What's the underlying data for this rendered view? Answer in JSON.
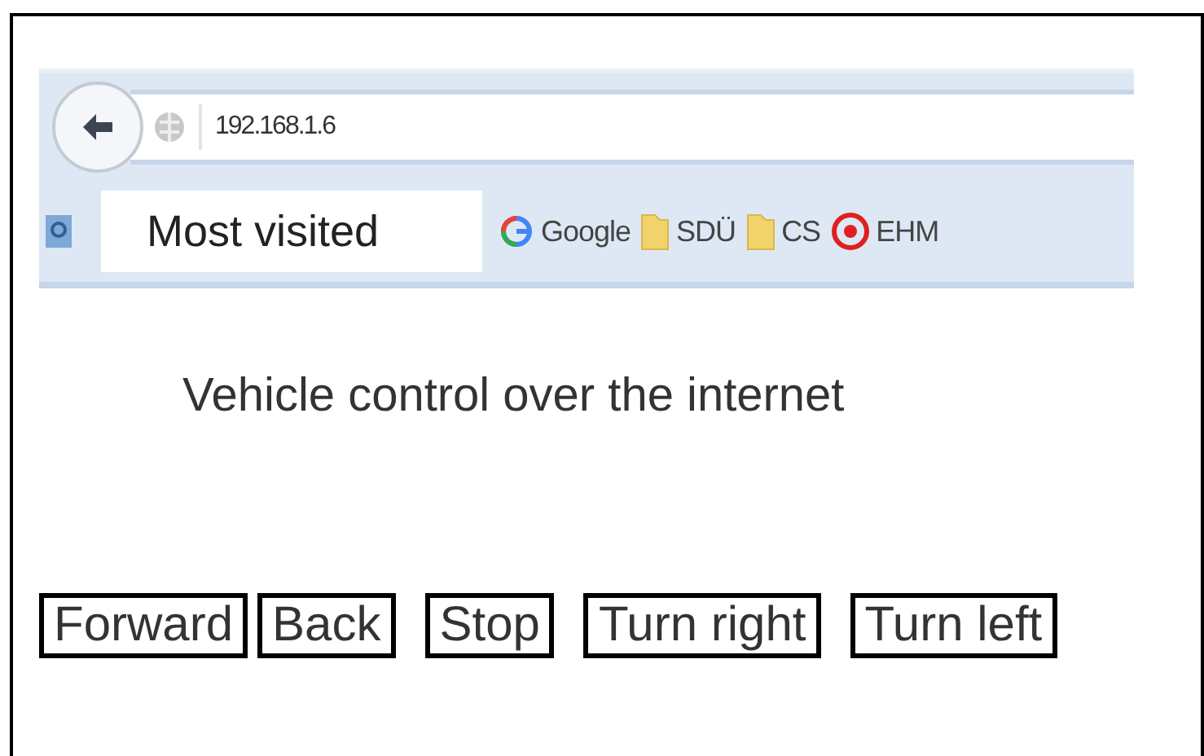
{
  "browser": {
    "address": "192.168.1.6",
    "most_visited": "Most visited",
    "bookmarks": [
      {
        "kind": "google",
        "label": "Google"
      },
      {
        "kind": "folder",
        "label": "SDÜ"
      },
      {
        "kind": "folder",
        "label": "CS"
      },
      {
        "kind": "target",
        "label": "EHM"
      }
    ]
  },
  "heading": "Vehicle control over the internet",
  "buttons": [
    "Forward",
    "Back",
    "Stop",
    "Turn right",
    "Turn left"
  ]
}
